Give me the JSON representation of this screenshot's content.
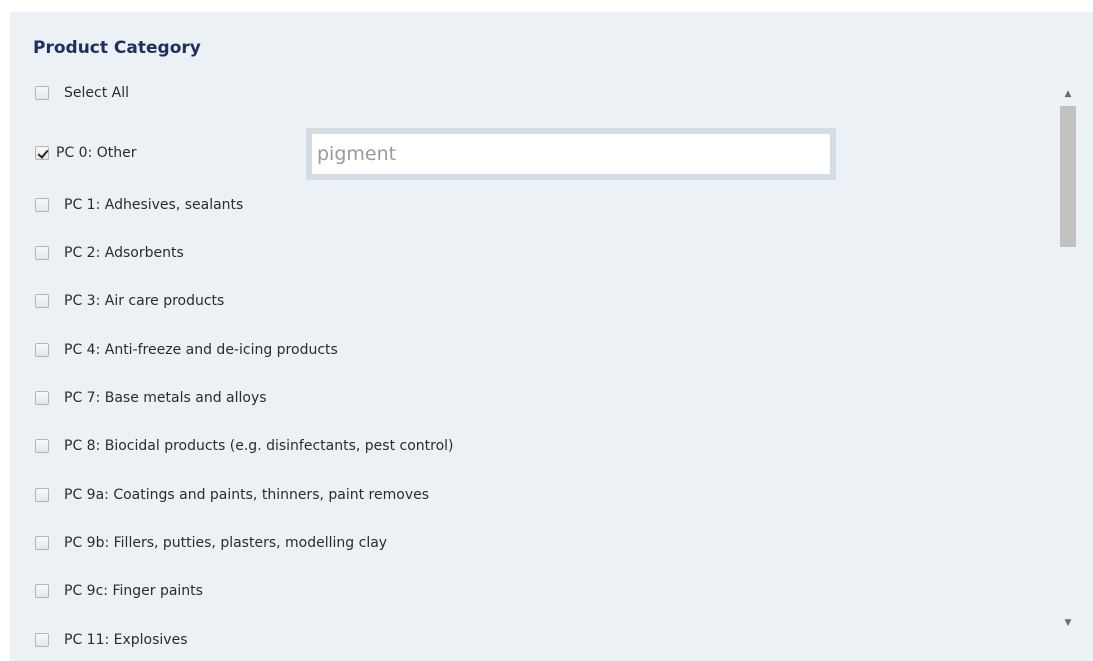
{
  "panel": {
    "title": "Product Category"
  },
  "select_all": {
    "label": "Select All",
    "checked": false
  },
  "search": {
    "value": "pigment"
  },
  "categories": [
    {
      "label": "PC 0: Other",
      "checked": true
    },
    {
      "label": "PC 1: Adhesives, sealants",
      "checked": false
    },
    {
      "label": "PC 2: Adsorbents",
      "checked": false
    },
    {
      "label": "PC 3: Air care products",
      "checked": false
    },
    {
      "label": "PC 4: Anti-freeze and de-icing products",
      "checked": false
    },
    {
      "label": "PC 7: Base metals and alloys",
      "checked": false
    },
    {
      "label": "PC 8: Biocidal products (e.g. disinfectants, pest control)",
      "checked": false
    },
    {
      "label": "PC 9a: Coatings and paints, thinners, paint removes",
      "checked": false
    },
    {
      "label": "PC 9b: Fillers, putties, plasters, modelling clay",
      "checked": false
    },
    {
      "label": "PC 9c: Finger paints",
      "checked": false
    },
    {
      "label": "PC 11: Explosives",
      "checked": false
    }
  ],
  "scrollbar": {
    "up_icon": "scroll-up-arrow",
    "down_icon": "scroll-down-arrow"
  }
}
